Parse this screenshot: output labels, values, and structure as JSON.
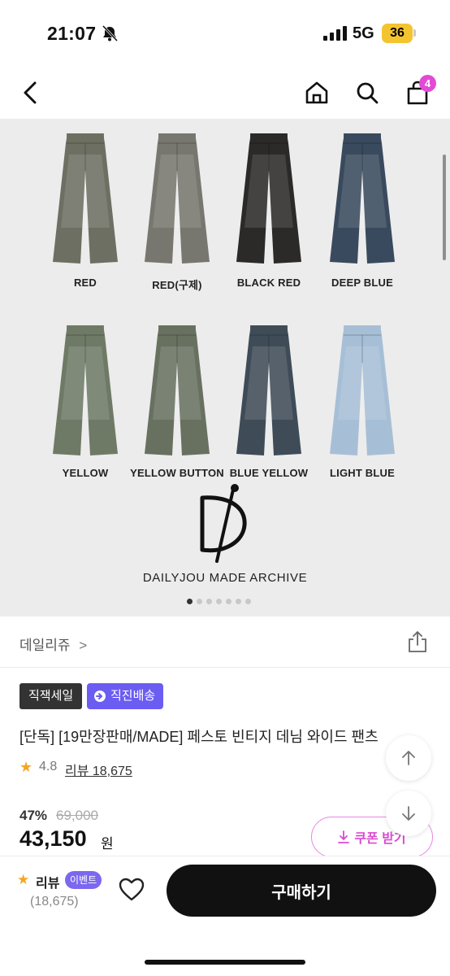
{
  "status_bar": {
    "time": "21:07",
    "network": "5G",
    "battery": "36"
  },
  "nav": {
    "cart_count": "4"
  },
  "hero": {
    "products": [
      {
        "label": "RED",
        "color": "#6d6f62"
      },
      {
        "label": "RED(구제)",
        "color": "#77776f"
      },
      {
        "label": "BLACK RED",
        "color": "#2b2a28"
      },
      {
        "label": "DEEP BLUE",
        "color": "#3a4a5e"
      },
      {
        "label": "YELLOW",
        "color": "#6f7a66"
      },
      {
        "label": "YELLOW BUTTON",
        "color": "#687160"
      },
      {
        "label": "BLUE YELLOW",
        "color": "#3f4c57"
      },
      {
        "label": "LIGHT BLUE",
        "color": "#a7bfd6"
      }
    ],
    "brand_caption": "DAILYJOU MADE ARCHIVE",
    "slide_count": 7,
    "active_slide": 0
  },
  "brand": {
    "name": "데일리쥬",
    "chevron": ">"
  },
  "tags": {
    "sale": "직잭세일",
    "delivery": "직진배송"
  },
  "product": {
    "title": "[단독] [19만장판매/MADE] 페스토 빈티지 데님 와이드 팬츠",
    "rating": "4.8",
    "review_label": "리뷰 18,675",
    "discount": "47%",
    "original_price": "69,000",
    "price": "43,150",
    "price_unit": "원"
  },
  "coupon": {
    "label": "쿠폰 받기"
  },
  "bottom_bar": {
    "review_label": "리뷰",
    "event_badge": "이벤트",
    "review_count": "(18,675)",
    "buy_label": "구매하기"
  },
  "colors": {
    "accent_pink": "#e24ad6",
    "accent_purple": "#6b5cf2",
    "star": "#f5a623"
  }
}
